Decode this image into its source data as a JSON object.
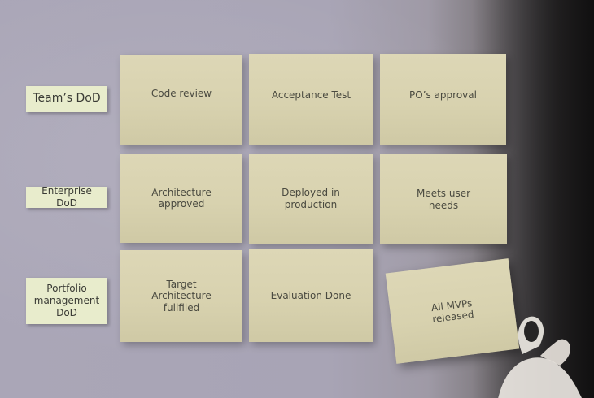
{
  "board": {
    "labels": {
      "team": "Team’s DoD",
      "enterprise": "Enterprise DoD",
      "portfolio": "Portfolio\nmanagement\nDoD"
    },
    "notes": {
      "code_review": "Code review",
      "acceptance_test": "Acceptance Test",
      "pos_approval": "PO’s approval",
      "architecture_approved": "Architecture\napproved",
      "deployed_in_production": "Deployed in\nproduction",
      "meets_user_needs": "Meets user\nneeds",
      "target_architecture": "Target\nArchitecture\nfullfiled",
      "evaluation_done": "Evaluation Done",
      "all_mvps_released": "All MVPs\nreleased"
    }
  },
  "colors": {
    "wall": "#a9a6b6",
    "sticky_note": "#d8d2af",
    "label_card": "#e8eccc",
    "text": "#4a4a40"
  }
}
